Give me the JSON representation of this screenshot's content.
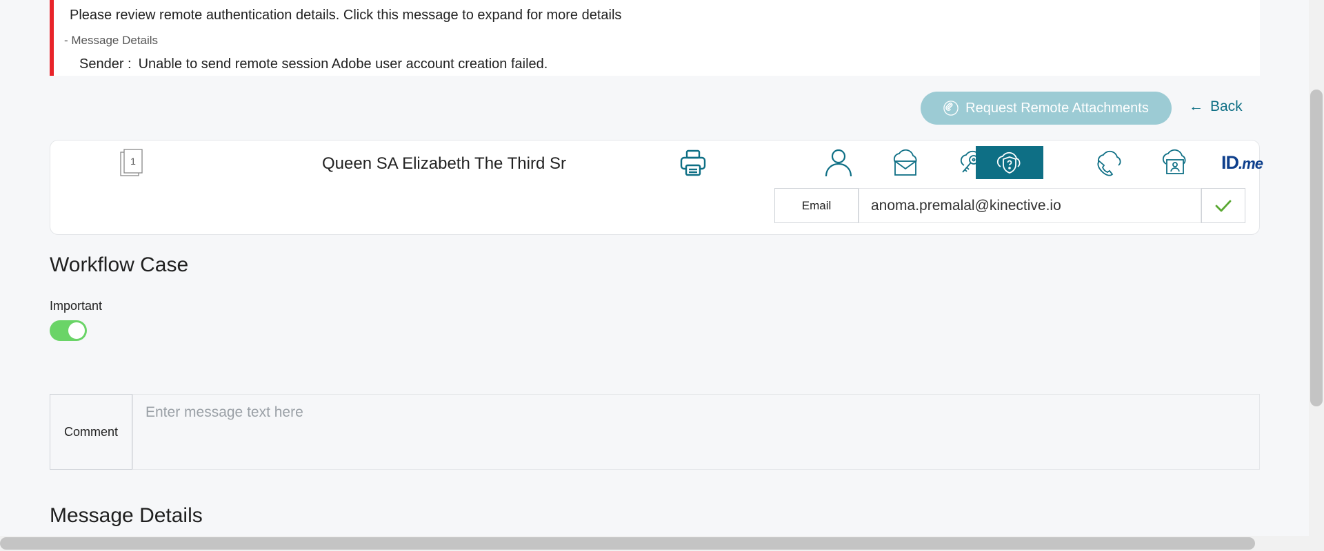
{
  "alert": {
    "title": "Please review remote authentication details. Click this message to expand for more details",
    "toggle_label": "- Message Details",
    "sender_label": "Sender :",
    "sender_message": "Unable to send remote session Adobe user account creation failed.",
    "accent_color": "#e8242a"
  },
  "actions": {
    "request_attachments_label": "Request Remote Attachments",
    "back_label": "Back",
    "back_arrow": "←"
  },
  "customer": {
    "page_count": "1",
    "name": "Queen SA Elizabeth The Third Sr",
    "tools": [
      {
        "icon": "user-icon"
      },
      {
        "icon": "cloud-mail-icon"
      },
      {
        "icon": "cloud-key-icon"
      },
      {
        "icon": "cloud-shield-question-icon",
        "active": true
      },
      {
        "icon": "cloud-phone-icon"
      },
      {
        "icon": "cloud-id-card-icon"
      },
      {
        "icon": "idme-logo",
        "text": "ID",
        "suffix": ".me"
      }
    ],
    "contact_type": "Email",
    "contact_value": "anoma.premalal@kinective.io"
  },
  "workflow": {
    "title": "Workflow Case",
    "important_label": "Important",
    "important_on": true,
    "comment_label": "Comment",
    "comment_placeholder": "Enter message text here"
  },
  "message_details": {
    "title": "Message Details"
  },
  "colors": {
    "brand": "#0e6f85",
    "attach_button": "#9ccbd4",
    "toggle_on": "#6ad467"
  }
}
